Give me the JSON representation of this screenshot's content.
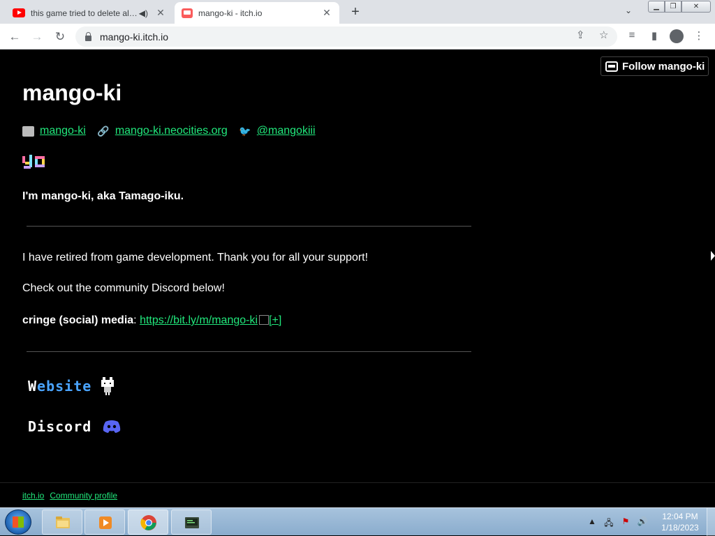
{
  "browser": {
    "tabs": [
      {
        "title": "this game tried to delete all of my files",
        "active": false,
        "icon": "youtube-icon"
      },
      {
        "title": "mango-ki - itch.io",
        "active": true,
        "icon": "itch-icon"
      }
    ],
    "new_tab_label": "+",
    "url": "mango-ki.itch.io"
  },
  "page": {
    "follow_button": "Follow mango-ki",
    "user_name": "mango-ki",
    "links": {
      "store": "mango-ki",
      "website": "mango-ki.neocities.org",
      "twitter": "@mangokiii"
    },
    "intro": "I'm mango-ki, aka Tamago-iku.",
    "para1": "I have retired from game development. Thank you for all your support!",
    "para2": "Check out the community Discord below!",
    "social_label": "cringe (social) media",
    "social_sep": ":",
    "social_link": "https://bit.ly/m/mango-ki",
    "social_extra": "[+]",
    "website_link_prefix": "W",
    "website_link_rest": "ebsite",
    "discord_link": "Discord",
    "footer": {
      "home": "itch.io",
      "profile": "Community profile"
    }
  },
  "taskbar": {
    "time": "12:04 PM",
    "date": "1/18/2023"
  },
  "colors": {
    "link": "#21e87c",
    "page_bg": "#000000",
    "discord": "#5865f2"
  }
}
